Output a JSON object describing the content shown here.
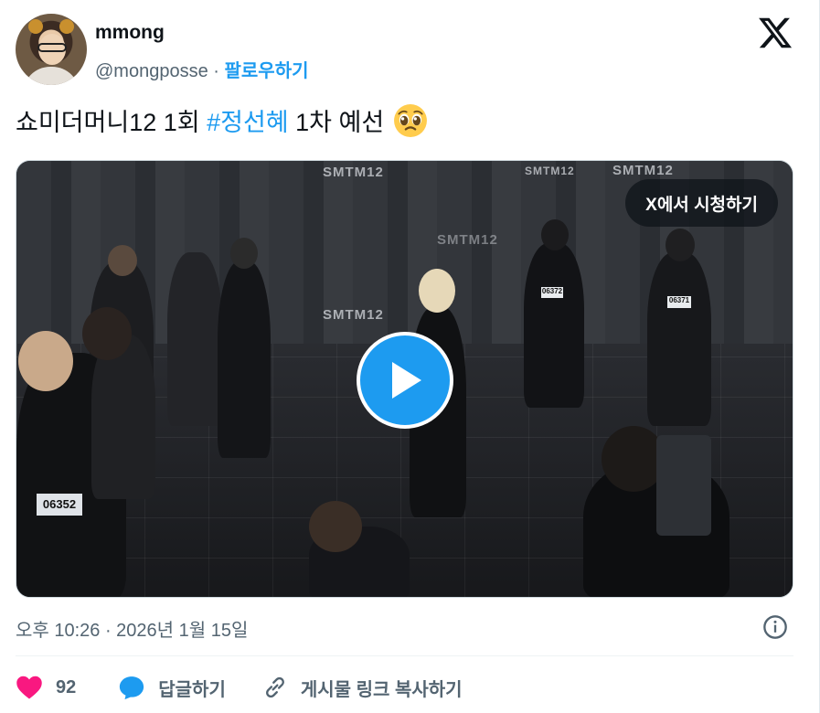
{
  "author": {
    "name": "mmong",
    "handle": "@mongposse",
    "separator": "·",
    "follow_label": "팔로우하기"
  },
  "tweet": {
    "text_before": "쇼미더머니12 1회 ",
    "hashtag": "#정선혜",
    "text_after": " 1차 예선",
    "emoji": "pleading-face-emoji"
  },
  "media": {
    "watch_label": "X에서 시청하기",
    "play_icon": "play-icon",
    "stage_marks": [
      "SMTM12",
      "SMTM12",
      "SMTM12",
      "SMTM12",
      "SMTM12"
    ],
    "badges": [
      "06372",
      "06371",
      "06352"
    ]
  },
  "timestamp": "오후 10:26 · 2026년 1월 15일",
  "actions": {
    "like_count": "92",
    "reply_label": "답글하기",
    "copy_link_label": "게시물 링크 복사하기"
  },
  "colors": {
    "accent": "#1d9bf0",
    "like": "#f91880",
    "text_secondary": "#536471"
  }
}
